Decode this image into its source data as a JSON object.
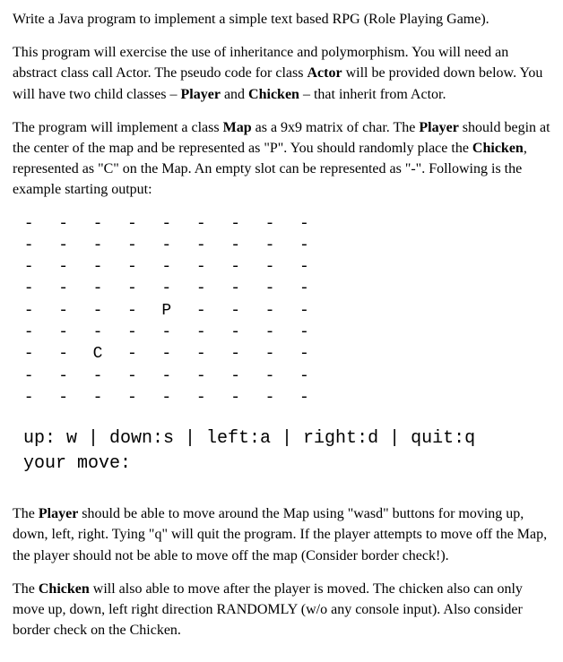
{
  "p1": "Write a Java program to implement a simple text based RPG (Role Playing Game).",
  "p2_a": "This program will exercise the use of inheritance and polymorphism. You will need an abstract class call Actor. The pseudo code for class ",
  "p2_b": "Actor",
  "p2_c": " will be provided down below. You will have two child classes – ",
  "p2_d": "Player",
  "p2_e": " and ",
  "p2_f": "Chicken",
  "p2_g": " – that inherit from Actor.",
  "p3_a": "The program will implement a class ",
  "p3_b": "Map",
  "p3_c": " as a 9x9 matrix of char. The ",
  "p3_d": "Player",
  "p3_e": " should begin at the center of the map and be represented as \"P\". You should randomly place the ",
  "p3_f": "Chicken",
  "p3_g": ", represented as \"C\" on the Map. An empty slot can be represented as \"-\". Following is the example starting output:",
  "map_grid": " -  -  -  -  -  -  -  -  -\n -  -  -  -  -  -  -  -  -\n -  -  -  -  -  -  -  -  -\n -  -  -  -  -  -  -  -  -\n -  -  -  -  P  -  -  -  -\n -  -  -  -  -  -  -  -  -\n -  -  C  -  -  -  -  -  -\n -  -  -  -  -  -  -  -  -\n -  -  -  -  -  -  -  -  -",
  "controls_text": " up: w | down:s | left:a | right:d | quit:q\n your move:",
  "p4_a": "The ",
  "p4_b": "Player",
  "p4_c": " should be able to move around the Map using \"wasd\" buttons for moving up, down, left, right. Tying \"q\" will quit the program. If the player attempts to move off the Map, the player should not be able to move off the map (Consider border check!).",
  "p5_a": "The ",
  "p5_b": "Chicken",
  "p5_c": " will also able to move after the player is moved. The chicken also can only move up, down, left right direction RANDOMLY (w/o any console input). Also consider border check on the Chicken."
}
